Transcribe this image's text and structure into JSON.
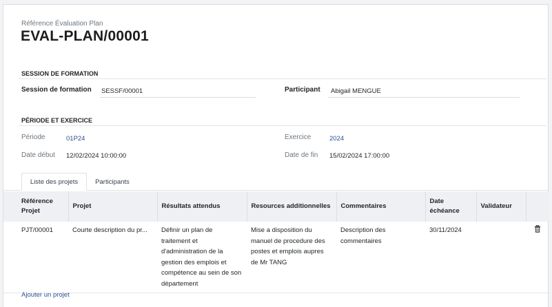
{
  "header": {
    "ref_label": "Référence Évaluation Plan",
    "ref_value": "EVAL-PLAN/00001"
  },
  "session_section": {
    "title": "SESSION DE FORMATION",
    "session_label": "Session de formation",
    "session_value": "SESSF/00001",
    "participant_label": "Participant",
    "participant_value": "Abigail MENGUE"
  },
  "period_section": {
    "title": "PÉRIODE ET EXERCICE",
    "periode_label": "Période",
    "periode_value": "01P24",
    "exercice_label": "Exercice",
    "exercice_value": "2024",
    "date_debut_label": "Date début",
    "date_debut_value": "12/02/2024 10:00:00",
    "date_fin_label": "Date de fin",
    "date_fin_value": "15/02/2024 17:00:00"
  },
  "tabs": [
    {
      "label": "Liste des projets",
      "active": true
    },
    {
      "label": "Participants",
      "active": false
    }
  ],
  "table": {
    "columns": [
      "Référence Projet",
      "Projet",
      "Résultats attendus",
      "Resources additionnelles",
      "Commentaires",
      "Date échéance",
      "Validateur"
    ],
    "rows": [
      {
        "reference": "PJT/00001",
        "projet": "Courte description du pr...",
        "resultats": "Définir un plan de traitement et d'administration de la gestion des emplois et compétence au sein de son département",
        "resources": "Mise a disposition du manuel de procedure des postes et emplois aupres de Mr TANG",
        "commentaires": "Description des commentaires",
        "date_echeance": "30/11/2024",
        "validateur": ""
      }
    ],
    "add_link": "Ajouter un projet",
    "delete_icon": "trash-icon"
  },
  "colors": {
    "link": "#2c4f8f",
    "header_bg": "#eef0f3",
    "muted": "#6c757d"
  }
}
